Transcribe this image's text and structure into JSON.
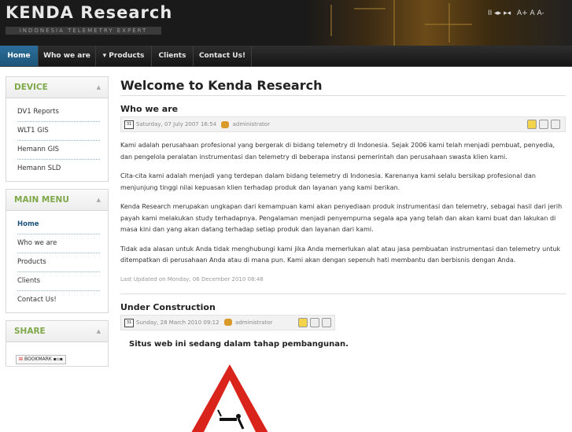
{
  "header": {
    "site_name": "KENDA Research",
    "tagline": "INDONESIA TELEMETRY EXPERT",
    "tools": {
      "controls": "II ◂▸ ▸◂",
      "font_sizes": "A+ A A-"
    }
  },
  "nav": {
    "items": [
      {
        "label": "Home",
        "active": true
      },
      {
        "label": "Who we are"
      },
      {
        "label": "▾ Products"
      },
      {
        "label": "Clients"
      },
      {
        "label": "Contact Us!"
      }
    ]
  },
  "sidebar": {
    "device": {
      "title": "DEVICE",
      "items": [
        "DV1 Reports",
        "WLT1 GIS",
        "Hemann GIS",
        "Hemann SLD"
      ]
    },
    "main_menu": {
      "title": "MAIN MENU",
      "items": [
        "Home",
        "Who we are",
        "Products",
        "Clients",
        "Contact Us!"
      ]
    },
    "share": {
      "title": "SHARE",
      "bookmark_label": "BOOKMARK"
    }
  },
  "main": {
    "page_title": "Welcome to Kenda Research",
    "article1": {
      "title": "Who we are",
      "date": "Saturday, 07 July 2007 16:54",
      "author": "administrator",
      "paragraphs": [
        "Kami adalah perusahaan profesional yang bergerak di bidang telemetry di Indonesia. Sejak 2006 kami telah menjadi pembuat, penyedia, dan pengelola peralatan instrumentasi dan telemetry di beberapa instansi pemerintah dan perusahaan swasta klien kami.",
        "Cita-cita kami adalah menjadi yang terdepan dalam bidang telemetry di Indonesia. Karenanya kami selalu bersikap profesional dan menjunjung tinggi nilai kepuasan klien terhadap produk dan layanan yang kami berikan.",
        "Kenda Research merupakan ungkapan dari kemampuan kami akan penyediaan produk instrumentasi dan telemetry, sebagai hasil dari jerih payah kami melakukan study terhadapnya. Pengalaman menjadi penyempurna segala apa yang telah dan akan kami buat dan lakukan di masa kini dan yang akan datang terhadap setiap produk dan layanan dari kami.",
        "Tidak ada alasan untuk Anda tidak menghubungi kami jika Anda memerlukan alat atau jasa pembuatan instrumentasi dan telemetry untuk ditempatkan di perusahaan Anda atau di mana pun. Kami akan dengan sepenuh hati membantu dan berbisnis dengan Anda."
      ],
      "last_updated": "Last Updated on Monday, 06 December 2010 08:48"
    },
    "article2": {
      "title": "Under Construction",
      "date": "Sunday, 28 March 2010 09:12",
      "author": "administrator",
      "message": "Situs web ini sedang dalam tahap pembangunan."
    }
  },
  "colors": {
    "accent_blue": "#1d5479",
    "module_title_green": "#7fa84a",
    "header_bg": "#1a1a1a",
    "sign_red": "#d9241c"
  }
}
